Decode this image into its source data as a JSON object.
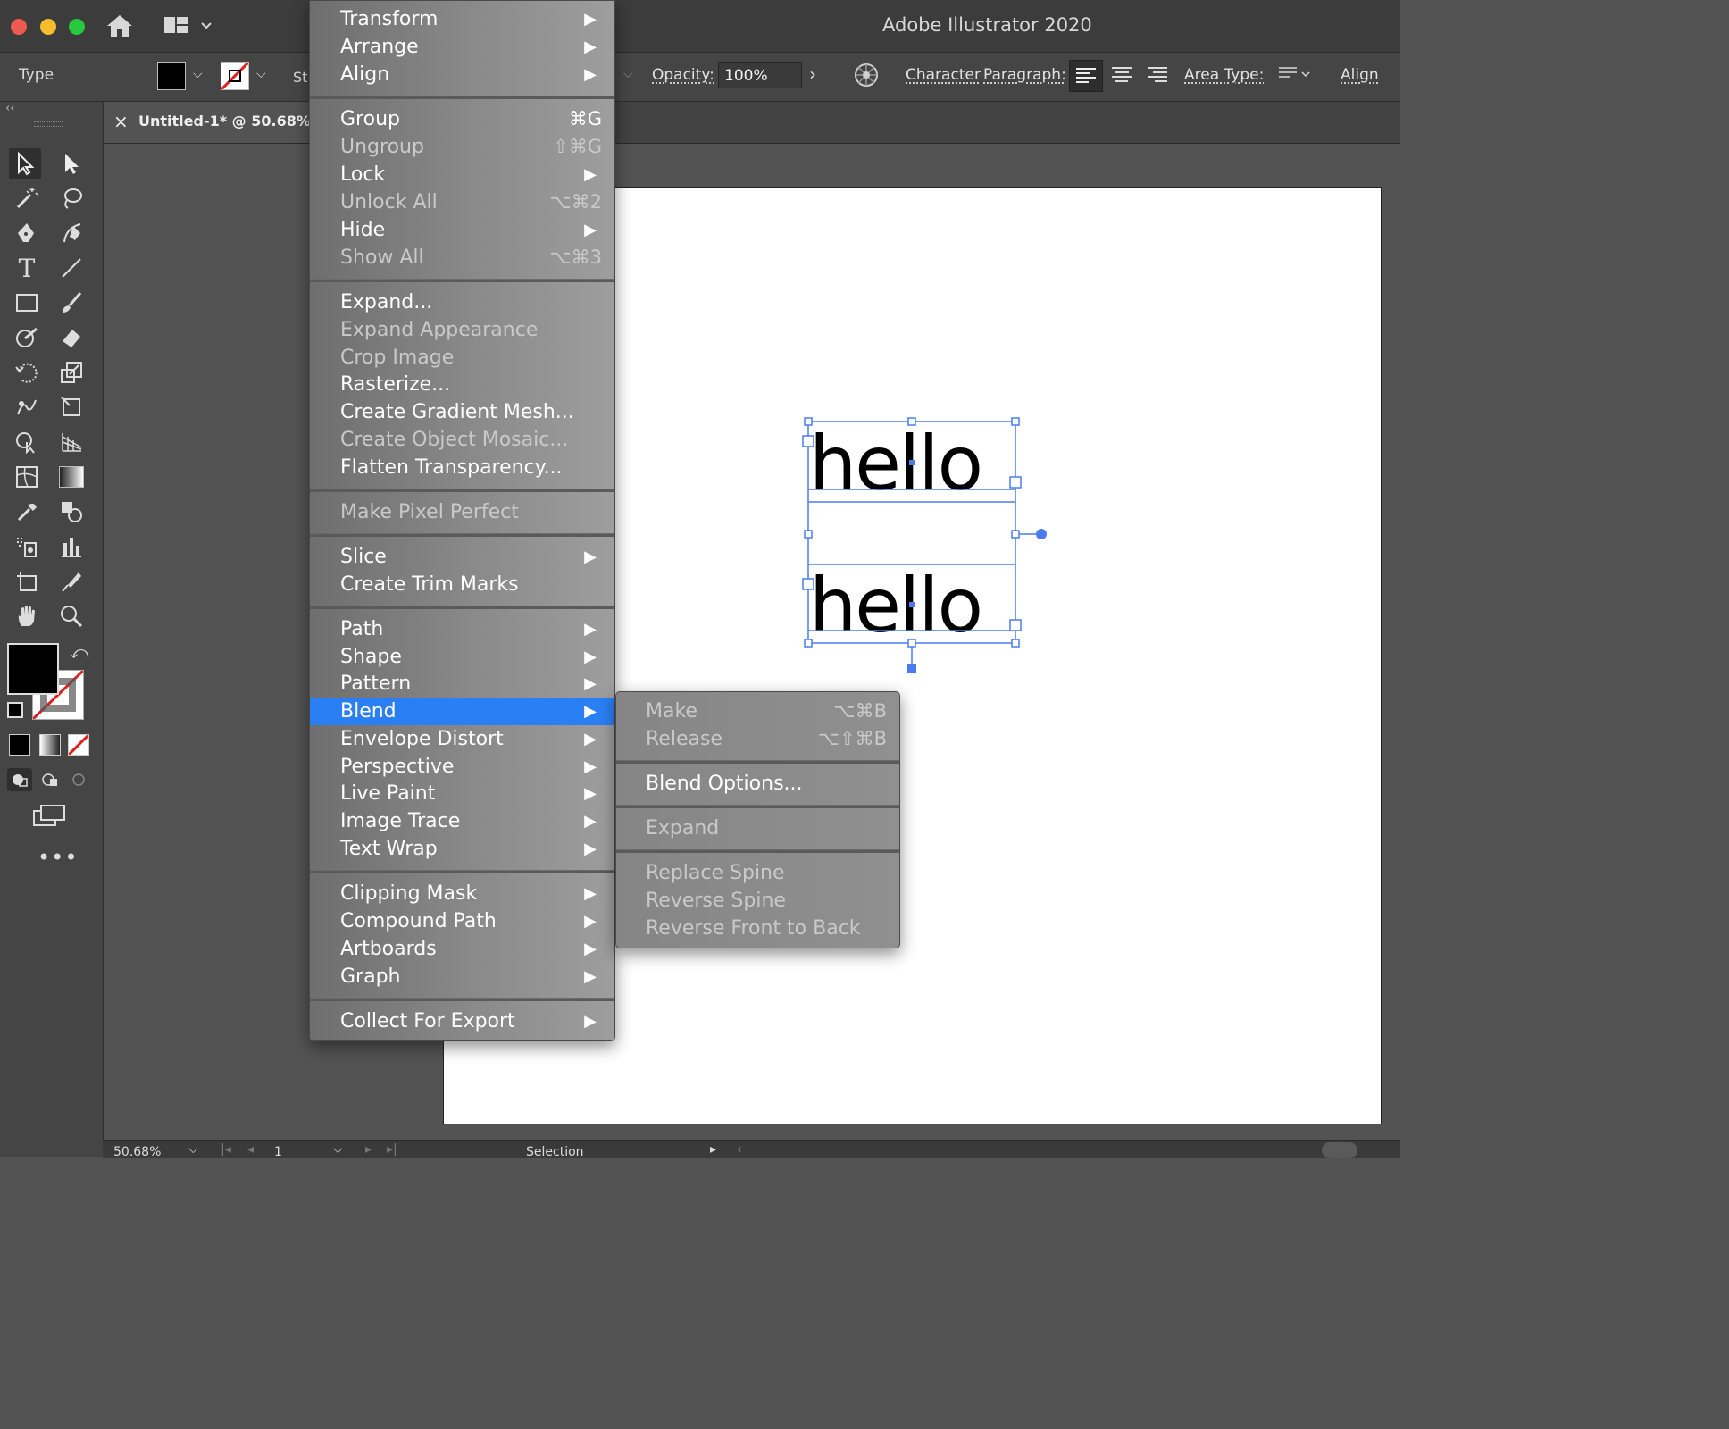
{
  "window": {
    "title": "Adobe Illustrator 2020"
  },
  "control_bar": {
    "selection_type": "Type",
    "stroke_label_partial": "St",
    "opacity_label": "Opacity:",
    "opacity_value": "100%",
    "character_label": "Character",
    "paragraph_label": "Paragraph:",
    "area_type_label": "Area Type:",
    "align_label": "Align"
  },
  "document_tab": {
    "close": "×",
    "title": "Untitled-1* @ 50.68% ("
  },
  "canvas": {
    "text_lines": [
      "hello",
      "hello"
    ]
  },
  "status_bar": {
    "zoom": "50.68%",
    "artboard": "1",
    "tool": "Selection"
  },
  "object_menu": {
    "items": [
      {
        "label": "Transform",
        "submenu": true
      },
      {
        "label": "Arrange",
        "submenu": true
      },
      {
        "label": "Align",
        "submenu": true
      },
      {
        "label": "Group",
        "shortcut": "⌘G"
      },
      {
        "label": "Ungroup",
        "shortcut": "⇧⌘G",
        "disabled": true
      },
      {
        "label": "Lock",
        "submenu": true
      },
      {
        "label": "Unlock All",
        "shortcut": "⌥⌘2",
        "disabled": true
      },
      {
        "label": "Hide",
        "submenu": true
      },
      {
        "label": "Show All",
        "shortcut": "⌥⌘3",
        "disabled": true
      },
      {
        "label": "Expand..."
      },
      {
        "label": "Expand Appearance",
        "disabled": true
      },
      {
        "label": "Crop Image",
        "disabled": true
      },
      {
        "label": "Rasterize..."
      },
      {
        "label": "Create Gradient Mesh..."
      },
      {
        "label": "Create Object Mosaic...",
        "disabled": true
      },
      {
        "label": "Flatten Transparency..."
      },
      {
        "label": "Make Pixel Perfect",
        "disabled": true
      },
      {
        "label": "Slice",
        "submenu": true
      },
      {
        "label": "Create Trim Marks"
      },
      {
        "label": "Path",
        "submenu": true
      },
      {
        "label": "Shape",
        "submenu": true
      },
      {
        "label": "Pattern",
        "submenu": true
      },
      {
        "label": "Blend",
        "submenu": true,
        "highlighted": true
      },
      {
        "label": "Envelope Distort",
        "submenu": true
      },
      {
        "label": "Perspective",
        "submenu": true
      },
      {
        "label": "Live Paint",
        "submenu": true
      },
      {
        "label": "Image Trace",
        "submenu": true
      },
      {
        "label": "Text Wrap",
        "submenu": true
      },
      {
        "label": "Clipping Mask",
        "submenu": true
      },
      {
        "label": "Compound Path",
        "submenu": true
      },
      {
        "label": "Artboards",
        "submenu": true
      },
      {
        "label": "Graph",
        "submenu": true
      },
      {
        "label": "Collect For Export",
        "submenu": true
      }
    ]
  },
  "blend_submenu": {
    "items": [
      {
        "label": "Make",
        "shortcut": "⌥⌘B",
        "disabled": true
      },
      {
        "label": "Release",
        "shortcut": "⌥⇧⌘B",
        "disabled": true
      },
      {
        "label": "Blend Options..."
      },
      {
        "label": "Expand",
        "disabled": true
      },
      {
        "label": "Replace Spine",
        "disabled": true
      },
      {
        "label": "Reverse Spine",
        "disabled": true
      },
      {
        "label": "Reverse Front to Back",
        "disabled": true
      }
    ]
  },
  "colors": {
    "highlight": "#2b7ff5",
    "selection": "#4a7cf0",
    "stroke_none": "#e02020"
  },
  "icons": {
    "home": "home-icon",
    "workspace": "workspace-switcher-icon",
    "recolor": "recolor-artwork-icon"
  }
}
